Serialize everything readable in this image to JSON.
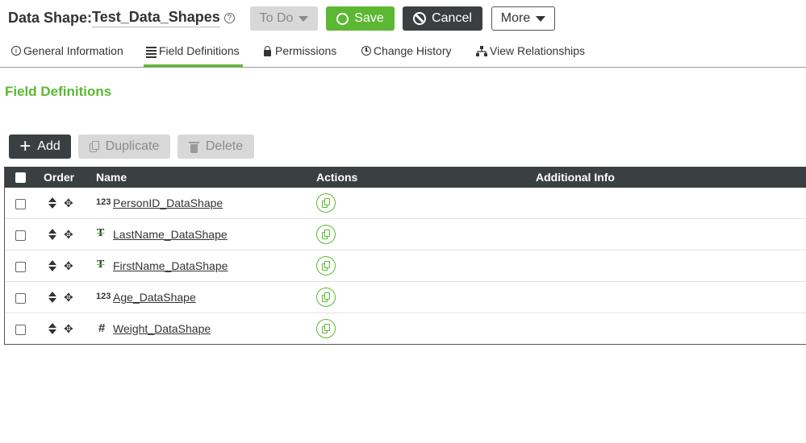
{
  "header": {
    "title_prefix": "Data Shape: ",
    "title_name": "Test_Data_Shapes",
    "help_icon": "help-circle-icon",
    "buttons": {
      "todo": "To Do",
      "save": "Save",
      "cancel": "Cancel",
      "more": "More"
    }
  },
  "tabs": [
    {
      "label": "General Information",
      "icon": "info-icon"
    },
    {
      "label": "Field Definitions",
      "icon": "list-icon",
      "active": true
    },
    {
      "label": "Permissions",
      "icon": "lock-icon"
    },
    {
      "label": "Change History",
      "icon": "clock-icon"
    },
    {
      "label": "View Relationships",
      "icon": "relationships-icon"
    }
  ],
  "section": {
    "title": "Field Definitions"
  },
  "actions": {
    "add": "Add",
    "duplicate": "Duplicate",
    "delete": "Delete"
  },
  "grid": {
    "columns": [
      "Order",
      "Name",
      "Actions",
      "Additional Info"
    ],
    "rows": [
      {
        "type_icon": "123",
        "type": "number",
        "name": "PersonID_DataShape"
      },
      {
        "type_icon": "T",
        "type": "string",
        "name": "LastName_DataShape"
      },
      {
        "type_icon": "T",
        "type": "string",
        "name": "FirstName_DataShape"
      },
      {
        "type_icon": "123",
        "type": "number",
        "name": "Age_DataShape"
      },
      {
        "type_icon": "#",
        "type": "number",
        "name": "Weight_DataShape"
      }
    ]
  },
  "colors": {
    "accent_green": "#5cb832",
    "dark": "#3a3f42",
    "disabled": "#d8d8d8"
  }
}
